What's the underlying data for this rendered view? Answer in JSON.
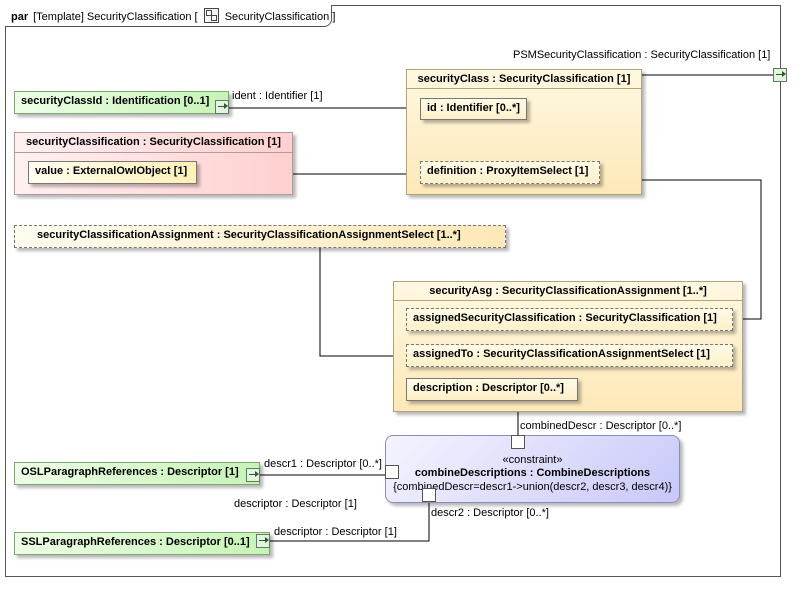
{
  "frame": {
    "keyword": "par",
    "title_prefix": "[Template] SecurityClassification [",
    "title_ref": "SecurityClassification",
    "title_suffix": "]",
    "block_icon": "block-icon"
  },
  "parts": {
    "security_class": "securityClass : SecurityClassification [1]",
    "id": "id : Identifier [0..*]",
    "definition": "definition : ProxyItemSelect [1]",
    "security_class_id": "securityClassId : Identification [0..1]",
    "security_classification": "securityClassification : SecurityClassification [1]",
    "value": "value : ExternalOwlObject [1]",
    "security_classification_assignment": "securityClassificationAssignment : SecurityClassificationAssignmentSelect [1..*]",
    "security_asg": "securityAsg : SecurityClassificationAssignment [1..*]",
    "assigned_security_classification": "assignedSecurityClassification : SecurityClassification [1]",
    "assigned_to": "assignedTo : SecurityClassificationAssignmentSelect [1]",
    "description": "description : Descriptor [0..*]",
    "osl": "OSLParagraphReferences : Descriptor [1]",
    "ssl": "SSLParagraphReferences : Descriptor [0..1]"
  },
  "constraint": {
    "stereotype": "«constraint»",
    "name": "combineDescriptions : CombineDescriptions",
    "expression": "{combinedDescr=descr1->union(descr2, descr3, descr4)}"
  },
  "labels": {
    "psm": "PSMSecurityClassification : SecurityClassification [1]",
    "ident": "ident : Identifier [1]",
    "combined_descr": "combinedDescr : Descriptor [0..*]",
    "descr1": "descr1 : Descriptor [0..*]",
    "descriptor_osl": "descriptor : Descriptor [1]",
    "descr2": "descr2 : Descriptor [0..*]",
    "descriptor_ssl": "descriptor : Descriptor [1]"
  },
  "colors": {
    "part_yellow": "#fde8b8",
    "part_green": "#c7f3b6",
    "part_pink": "#ffd0d0",
    "constraint_blue": "#c8c8fa",
    "connector": "#000000"
  }
}
